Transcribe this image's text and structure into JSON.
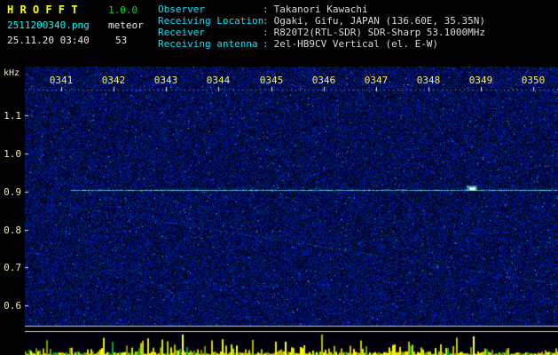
{
  "header": {
    "app_title": "H R O F F T",
    "version": "1.0.0",
    "filename": "2511200340.png",
    "mode": "meteor",
    "datetime": "25.11.20 03:40",
    "count": "53",
    "separator": ":",
    "info": [
      {
        "label": "Observer",
        "value": "Takanori Kawachi"
      },
      {
        "label": "Receiving Location",
        "value": "Ogaki, Gifu, JAPAN (136.60E, 35.35N)"
      },
      {
        "label": "Receiver",
        "value": "R820T2(RTL-SDR) SDR-Sharp 53.1000MHz"
      },
      {
        "label": "Receiving antenna",
        "value": "2el-HB9CV Vertical (el. E-W)"
      }
    ]
  },
  "axis": {
    "unit": "kHz",
    "y_ticks": [
      "1.1",
      "1.0",
      "0.9",
      "0.8",
      "0.7",
      "0.6"
    ],
    "time_ticks": [
      "0341",
      "0342",
      "0343",
      "0344",
      "0345",
      "0346",
      "0347",
      "0348",
      "0349",
      "0350"
    ]
  },
  "chart_data": {
    "type": "heatmap",
    "title": "HROFFT radio meteor echo spectrogram 03:40-03:50",
    "x": [
      "0341",
      "0342",
      "0343",
      "0344",
      "0345",
      "0346",
      "0347",
      "0348",
      "0349",
      "0350"
    ],
    "ylabel": "kHz",
    "ylim": [
      0.55,
      1.15
    ],
    "carrier_line_khz": 0.91,
    "meteor_echo": {
      "time": "0348.7",
      "khz": 0.92
    },
    "colors": {
      "background": "#000014",
      "noise": "#0033aa",
      "carrier": "#78fffa",
      "tick_text": "#ffee55",
      "bars_yellow": "#d8d800",
      "bars_green": "#00a040",
      "separator": "#cccccc"
    }
  }
}
